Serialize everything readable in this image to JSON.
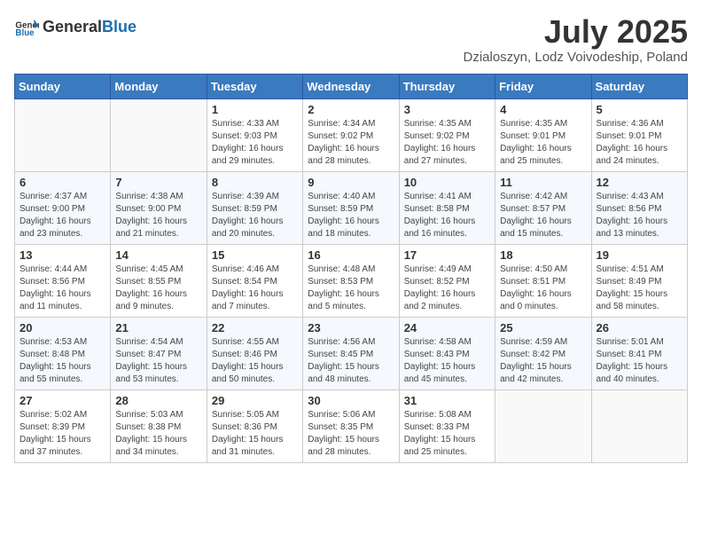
{
  "header": {
    "logo_general": "General",
    "logo_blue": "Blue",
    "title": "July 2025",
    "subtitle": "Dzialoszyn, Lodz Voivodeship, Poland"
  },
  "calendar": {
    "days_of_week": [
      "Sunday",
      "Monday",
      "Tuesday",
      "Wednesday",
      "Thursday",
      "Friday",
      "Saturday"
    ],
    "weeks": [
      [
        {
          "day": "",
          "content": ""
        },
        {
          "day": "",
          "content": ""
        },
        {
          "day": "1",
          "content": "Sunrise: 4:33 AM\nSunset: 9:03 PM\nDaylight: 16 hours and 29 minutes."
        },
        {
          "day": "2",
          "content": "Sunrise: 4:34 AM\nSunset: 9:02 PM\nDaylight: 16 hours and 28 minutes."
        },
        {
          "day": "3",
          "content": "Sunrise: 4:35 AM\nSunset: 9:02 PM\nDaylight: 16 hours and 27 minutes."
        },
        {
          "day": "4",
          "content": "Sunrise: 4:35 AM\nSunset: 9:01 PM\nDaylight: 16 hours and 25 minutes."
        },
        {
          "day": "5",
          "content": "Sunrise: 4:36 AM\nSunset: 9:01 PM\nDaylight: 16 hours and 24 minutes."
        }
      ],
      [
        {
          "day": "6",
          "content": "Sunrise: 4:37 AM\nSunset: 9:00 PM\nDaylight: 16 hours and 23 minutes."
        },
        {
          "day": "7",
          "content": "Sunrise: 4:38 AM\nSunset: 9:00 PM\nDaylight: 16 hours and 21 minutes."
        },
        {
          "day": "8",
          "content": "Sunrise: 4:39 AM\nSunset: 8:59 PM\nDaylight: 16 hours and 20 minutes."
        },
        {
          "day": "9",
          "content": "Sunrise: 4:40 AM\nSunset: 8:59 PM\nDaylight: 16 hours and 18 minutes."
        },
        {
          "day": "10",
          "content": "Sunrise: 4:41 AM\nSunset: 8:58 PM\nDaylight: 16 hours and 16 minutes."
        },
        {
          "day": "11",
          "content": "Sunrise: 4:42 AM\nSunset: 8:57 PM\nDaylight: 16 hours and 15 minutes."
        },
        {
          "day": "12",
          "content": "Sunrise: 4:43 AM\nSunset: 8:56 PM\nDaylight: 16 hours and 13 minutes."
        }
      ],
      [
        {
          "day": "13",
          "content": "Sunrise: 4:44 AM\nSunset: 8:56 PM\nDaylight: 16 hours and 11 minutes."
        },
        {
          "day": "14",
          "content": "Sunrise: 4:45 AM\nSunset: 8:55 PM\nDaylight: 16 hours and 9 minutes."
        },
        {
          "day": "15",
          "content": "Sunrise: 4:46 AM\nSunset: 8:54 PM\nDaylight: 16 hours and 7 minutes."
        },
        {
          "day": "16",
          "content": "Sunrise: 4:48 AM\nSunset: 8:53 PM\nDaylight: 16 hours and 5 minutes."
        },
        {
          "day": "17",
          "content": "Sunrise: 4:49 AM\nSunset: 8:52 PM\nDaylight: 16 hours and 2 minutes."
        },
        {
          "day": "18",
          "content": "Sunrise: 4:50 AM\nSunset: 8:51 PM\nDaylight: 16 hours and 0 minutes."
        },
        {
          "day": "19",
          "content": "Sunrise: 4:51 AM\nSunset: 8:49 PM\nDaylight: 15 hours and 58 minutes."
        }
      ],
      [
        {
          "day": "20",
          "content": "Sunrise: 4:53 AM\nSunset: 8:48 PM\nDaylight: 15 hours and 55 minutes."
        },
        {
          "day": "21",
          "content": "Sunrise: 4:54 AM\nSunset: 8:47 PM\nDaylight: 15 hours and 53 minutes."
        },
        {
          "day": "22",
          "content": "Sunrise: 4:55 AM\nSunset: 8:46 PM\nDaylight: 15 hours and 50 minutes."
        },
        {
          "day": "23",
          "content": "Sunrise: 4:56 AM\nSunset: 8:45 PM\nDaylight: 15 hours and 48 minutes."
        },
        {
          "day": "24",
          "content": "Sunrise: 4:58 AM\nSunset: 8:43 PM\nDaylight: 15 hours and 45 minutes."
        },
        {
          "day": "25",
          "content": "Sunrise: 4:59 AM\nSunset: 8:42 PM\nDaylight: 15 hours and 42 minutes."
        },
        {
          "day": "26",
          "content": "Sunrise: 5:01 AM\nSunset: 8:41 PM\nDaylight: 15 hours and 40 minutes."
        }
      ],
      [
        {
          "day": "27",
          "content": "Sunrise: 5:02 AM\nSunset: 8:39 PM\nDaylight: 15 hours and 37 minutes."
        },
        {
          "day": "28",
          "content": "Sunrise: 5:03 AM\nSunset: 8:38 PM\nDaylight: 15 hours and 34 minutes."
        },
        {
          "day": "29",
          "content": "Sunrise: 5:05 AM\nSunset: 8:36 PM\nDaylight: 15 hours and 31 minutes."
        },
        {
          "day": "30",
          "content": "Sunrise: 5:06 AM\nSunset: 8:35 PM\nDaylight: 15 hours and 28 minutes."
        },
        {
          "day": "31",
          "content": "Sunrise: 5:08 AM\nSunset: 8:33 PM\nDaylight: 15 hours and 25 minutes."
        },
        {
          "day": "",
          "content": ""
        },
        {
          "day": "",
          "content": ""
        }
      ]
    ]
  }
}
